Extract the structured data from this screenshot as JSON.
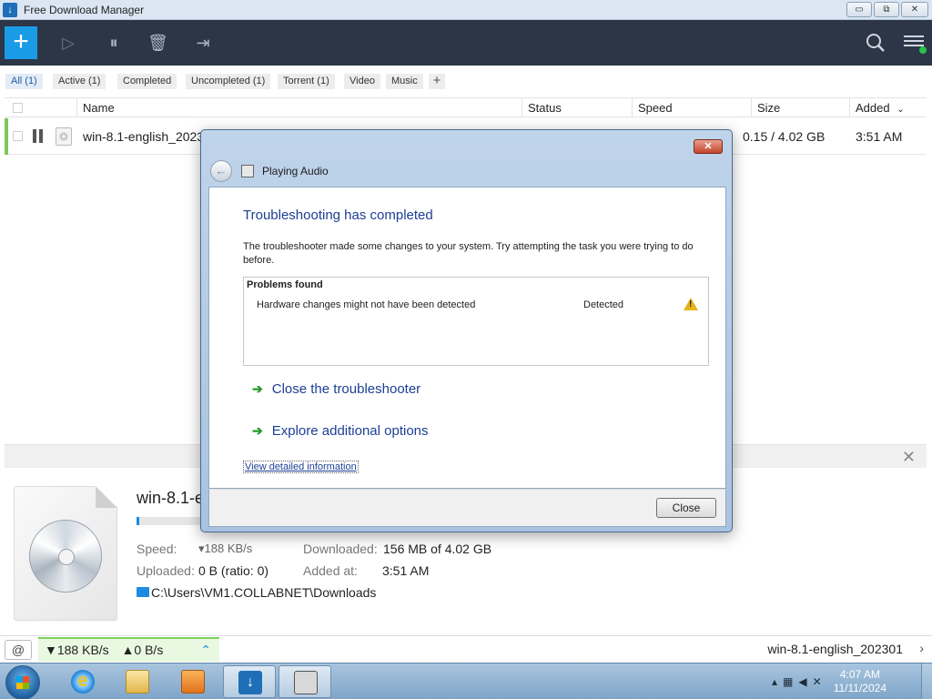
{
  "window": {
    "title": "Free Download Manager",
    "minimize_glyph": "▭",
    "restore_glyph": "⧉",
    "close_glyph": "✕"
  },
  "toolbar": {
    "add_glyph": "+",
    "icons": [
      "add-icon",
      "play-icon",
      "pause-icon",
      "delete-icon",
      "move-folder-icon",
      "search-icon",
      "menu-icon"
    ]
  },
  "filters": [
    "All (1)",
    "Active (1)",
    "Completed",
    "Uncompleted (1)",
    "Torrent (1)",
    "Video",
    "Music"
  ],
  "filter_add": "+",
  "columns": {
    "name": "Name",
    "status": "Status",
    "speed": "Speed",
    "size": "Size",
    "added": "Added"
  },
  "downloads": [
    {
      "name": "win-8.1-english_202301",
      "size": "0.15 / 4.02 GB",
      "added": "3:51 AM"
    }
  ],
  "details": {
    "name": "win-8.1-english_202301",
    "progress_percent": 4,
    "speed_label": "Speed:",
    "speed_value": "▾188 KB/s",
    "downloaded_label": "Downloaded:",
    "downloaded_value": "156 MB of 4.02 GB",
    "uploaded_label": "Uploaded:",
    "uploaded_value": "0 B (ratio: 0)",
    "added_label": "Added at:",
    "added_value": "3:51 AM",
    "path": "C:\\Users\\VM1.COLLABNET\\Downloads"
  },
  "statusbar": {
    "down_speed": "▼188 KB/s",
    "up_speed": "▲0 B/s",
    "current_file": "win-8.1-english_202301"
  },
  "dialog": {
    "title": "Playing Audio",
    "heading": "Troubleshooting has completed",
    "description": "The troubleshooter made some changes to your system. Try attempting the task you were trying to do before.",
    "problems_header": "Problems found",
    "problem_item": "Hardware changes might not have been detected",
    "problem_status": "Detected",
    "command_close": "Close the troubleshooter",
    "command_explore": "Explore additional options",
    "details_link": "View detailed information",
    "close_button": "Close",
    "close_glyph": "✕"
  },
  "taskbar": {
    "time": "4:07 AM",
    "date": "11/11/2024"
  },
  "colors": {
    "toolbar_bg": "#2c3646",
    "accent_blue": "#1a9be6",
    "active_green": "#7dc75b",
    "link_blue": "#1c3f94"
  }
}
